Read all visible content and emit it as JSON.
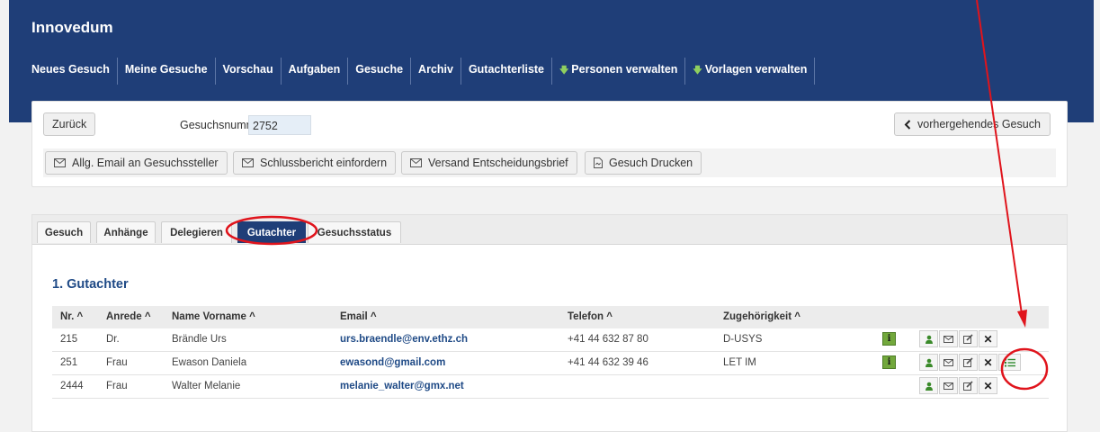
{
  "app": {
    "title": "Innovedum"
  },
  "nav": {
    "items": [
      {
        "label": "Neues Gesuch",
        "dl": false
      },
      {
        "label": "Meine Gesuche",
        "dl": false
      },
      {
        "label": "Vorschau",
        "dl": false
      },
      {
        "label": "Aufgaben",
        "dl": false
      },
      {
        "label": "Gesuche",
        "dl": false
      },
      {
        "label": "Archiv",
        "dl": false
      },
      {
        "label": "Gutachterliste",
        "dl": false
      },
      {
        "label": "Personen verwalten",
        "dl": true
      },
      {
        "label": "Vorlagen verwalten",
        "dl": true
      }
    ]
  },
  "header_panel": {
    "back_label": "Zurück",
    "gesuchsnummer_label": "Gesuchsnummer:",
    "gesuchsnummer_value": "2752",
    "prev_label": "vorhergehendes Gesuch",
    "actions": {
      "email": "Allg. Email an Gesuchssteller",
      "schlussbericht": "Schlussbericht einfordern",
      "versand": "Versand Entscheidungsbrief",
      "drucken": "Gesuch Drucken"
    }
  },
  "tabs": {
    "gesuch": "Gesuch",
    "anhaenge": "Anhänge",
    "delegieren": "Delegieren",
    "gutachter": "Gutachter",
    "status": "Gesuchsstatus"
  },
  "section": {
    "title": "1. Gutachter"
  },
  "table": {
    "headers": {
      "nr": "Nr. ^",
      "anrede": "Anrede ^",
      "name": "Name Vorname ^",
      "email": "Email ^",
      "telefon": "Telefon ^",
      "zug": "Zugehörigkeit ^"
    },
    "rows": [
      {
        "nr": "215",
        "anrede": "Dr.",
        "name": "Brändle Urs",
        "email": "urs.braendle@env.ethz.ch",
        "telefon": "+41 44 632 87 80",
        "zug": "D-USYS",
        "info": "i"
      },
      {
        "nr": "251",
        "anrede": "Frau",
        "name": "Ewason Daniela",
        "email": "ewasond@gmail.com",
        "telefon": "+41 44 632 39 46",
        "zug": "LET IM",
        "info": "i"
      },
      {
        "nr": "2444",
        "anrede": "Frau",
        "name": "Walter Melanie",
        "email": "melanie_walter@gmx.net",
        "telefon": "",
        "zug": ""
      }
    ]
  },
  "colors": {
    "header_bg": "#1f3e78",
    "annotation": "#e0141c",
    "info_green": "#72a83c",
    "link": "#1f4a86"
  },
  "icons": [
    "arrow-down-icon",
    "envelope-icon",
    "pdf-file-icon",
    "chevron-left-icon",
    "user-icon",
    "edit-icon",
    "close-icon",
    "list-icon",
    "info-icon"
  ]
}
